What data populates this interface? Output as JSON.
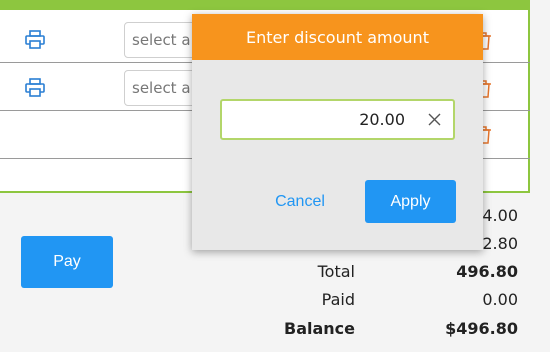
{
  "order_rows": [
    {
      "printer_icon": "printer-icon",
      "select_placeholder": "select a",
      "delete_icon": "trash-icon"
    },
    {
      "printer_icon": "printer-icon",
      "select_placeholder": "select a",
      "delete_icon": "trash-icon"
    },
    {
      "delete_icon": "trash-icon"
    }
  ],
  "pay_label": "Pay",
  "summary": {
    "partial_value_1": "4.00",
    "partial_value_2": "2.80",
    "total_label": "Total",
    "total_value": "496.80",
    "paid_label": "Paid",
    "paid_value": "0.00",
    "balance_label": "Balance",
    "balance_value": "$496.80"
  },
  "discount_dialog": {
    "title": "Enter discount amount",
    "amount": "20.00",
    "clear_icon": "close-icon",
    "cancel_label": "Cancel",
    "apply_label": "Apply"
  },
  "colors": {
    "accent_green": "#8dc63f",
    "dialog_header": "#f7941d",
    "primary_blue": "#2196f3",
    "delete_orange": "#e8762c"
  }
}
